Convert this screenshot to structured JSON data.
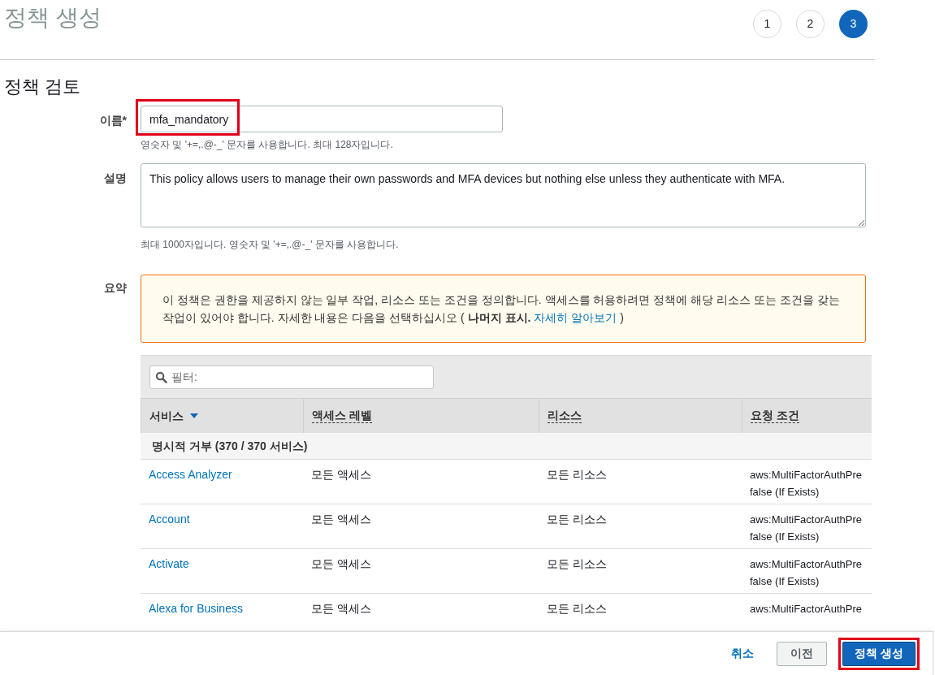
{
  "page_title": "정책 생성",
  "steps": [
    {
      "label": "1",
      "selected": false
    },
    {
      "label": "2",
      "selected": false
    },
    {
      "label": "3",
      "selected": true
    }
  ],
  "section_title": "정책 검토",
  "name_field": {
    "label": "이름*",
    "value": "mfa_mandatory",
    "highlighted": true,
    "hint": "영숫자 및 '+=,.@-_' 문자를 사용합니다. 최대 128자입니다."
  },
  "description_field": {
    "label": "설명",
    "value": "This policy allows users to manage their own passwords and MFA devices but nothing else unless they authenticate with MFA.",
    "hint": "최대 1000자입니다. 영숫자 및 '+=,.@-_' 문자를 사용합니다."
  },
  "summary": {
    "label": "요약",
    "notice": {
      "text": "이 정책은 권한을 제공하지 않는 일부 작업, 리소스 또는 조건을 정의합니다. 액세스를 허용하려면 정책에 해당 리소스 또는 조건을 갖는 작업이 있어야 합니다. 자세한 내용은 다음을 선택하십시오 (",
      "bold_link": "나머지 표시.",
      "link": "자세히 알아보기",
      "close": ")"
    },
    "filter": {
      "placeholder": "필터:"
    },
    "table": {
      "columns": [
        {
          "label": "서비스",
          "sorted": true
        },
        {
          "label": "액세스 레벨",
          "sorted": false
        },
        {
          "label": "리소스",
          "sorted": false
        },
        {
          "label": "요청 조건",
          "sorted": false
        }
      ],
      "group": "명시적 거부 (370 / 370 서비스)",
      "rows": [
        {
          "service": "Access Analyzer",
          "access": "모든 액세스",
          "resource": "모든 리소스",
          "condition": [
            "aws:MultiFactorAuthPre",
            "false (If Exists)"
          ]
        },
        {
          "service": "Account",
          "access": "모든 액세스",
          "resource": "모든 리소스",
          "condition": [
            "aws:MultiFactorAuthPre",
            "false (If Exists)"
          ]
        },
        {
          "service": "Activate",
          "access": "모든 액세스",
          "resource": "모든 리소스",
          "condition": [
            "aws:MultiFactorAuthPre",
            "false (If Exists)"
          ]
        },
        {
          "service": "Alexa for Business",
          "access": "모든 액세스",
          "resource": "모든 리소스",
          "condition": [
            "aws:MultiFactorAuthPre"
          ]
        }
      ]
    }
  },
  "footer": {
    "cancel": "취소",
    "previous": "이전",
    "create": {
      "label": "정책 생성",
      "highlighted": true
    }
  }
}
